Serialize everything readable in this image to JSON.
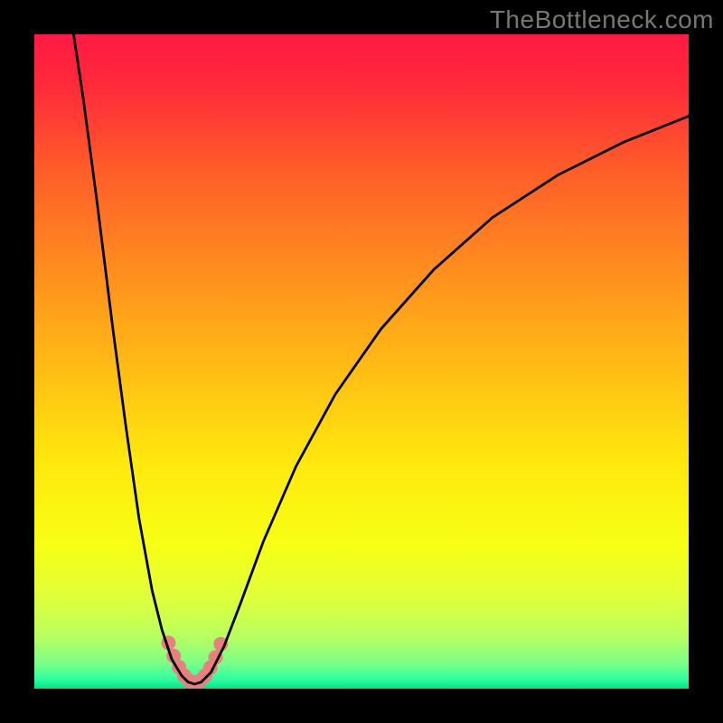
{
  "watermark": "TheBottleneck.com",
  "gradient": {
    "stops": [
      {
        "offset": 0.0,
        "color": "#ff1a44"
      },
      {
        "offset": 0.08,
        "color": "#ff2a3a"
      },
      {
        "offset": 0.2,
        "color": "#ff5a2a"
      },
      {
        "offset": 0.35,
        "color": "#ff8a1f"
      },
      {
        "offset": 0.5,
        "color": "#ffb915"
      },
      {
        "offset": 0.65,
        "color": "#ffe70e"
      },
      {
        "offset": 0.78,
        "color": "#f7ff14"
      },
      {
        "offset": 0.86,
        "color": "#e0ff3a"
      },
      {
        "offset": 0.92,
        "color": "#b8ff60"
      },
      {
        "offset": 0.96,
        "color": "#7dff86"
      },
      {
        "offset": 0.985,
        "color": "#30ffa0"
      },
      {
        "offset": 1.0,
        "color": "#00e585"
      }
    ]
  },
  "chart_data": {
    "type": "line",
    "title": "",
    "xlabel": "",
    "ylabel": "",
    "series": [
      {
        "name": "bottleneck-curve",
        "x_range_pct": [
          0,
          100
        ],
        "y_range_pct": [
          0,
          100
        ],
        "note": "Values are expressed as percent of plot width (x) and percent of plot height from top (y). Lower y means closer to top (worse bottleneck); y≈100 is the green optimum.",
        "points": [
          {
            "x_pct": 6.0,
            "y_pct": 0.0
          },
          {
            "x_pct": 7.5,
            "y_pct": 10.0
          },
          {
            "x_pct": 9.5,
            "y_pct": 25.0
          },
          {
            "x_pct": 12.0,
            "y_pct": 45.0
          },
          {
            "x_pct": 14.0,
            "y_pct": 60.0
          },
          {
            "x_pct": 16.0,
            "y_pct": 74.0
          },
          {
            "x_pct": 18.0,
            "y_pct": 85.0
          },
          {
            "x_pct": 19.5,
            "y_pct": 91.0
          },
          {
            "x_pct": 21.0,
            "y_pct": 95.5
          },
          {
            "x_pct": 22.5,
            "y_pct": 98.0
          },
          {
            "x_pct": 23.5,
            "y_pct": 99.0
          },
          {
            "x_pct": 24.5,
            "y_pct": 99.3
          },
          {
            "x_pct": 25.5,
            "y_pct": 99.0
          },
          {
            "x_pct": 27.0,
            "y_pct": 97.5
          },
          {
            "x_pct": 29.0,
            "y_pct": 93.5
          },
          {
            "x_pct": 31.5,
            "y_pct": 87.0
          },
          {
            "x_pct": 35.0,
            "y_pct": 77.5
          },
          {
            "x_pct": 40.0,
            "y_pct": 66.0
          },
          {
            "x_pct": 46.0,
            "y_pct": 55.0
          },
          {
            "x_pct": 53.0,
            "y_pct": 45.0
          },
          {
            "x_pct": 61.0,
            "y_pct": 36.0
          },
          {
            "x_pct": 70.0,
            "y_pct": 28.0
          },
          {
            "x_pct": 80.0,
            "y_pct": 21.5
          },
          {
            "x_pct": 90.0,
            "y_pct": 16.5
          },
          {
            "x_pct": 100.0,
            "y_pct": 12.5
          }
        ]
      },
      {
        "name": "highlight-dots",
        "color": "#e98080",
        "radius_px": 8,
        "points": [
          {
            "x_pct": 20.5,
            "y_pct": 93.0
          },
          {
            "x_pct": 21.3,
            "y_pct": 95.0
          },
          {
            "x_pct": 22.1,
            "y_pct": 96.7
          },
          {
            "x_pct": 22.9,
            "y_pct": 98.0
          },
          {
            "x_pct": 23.7,
            "y_pct": 98.8
          },
          {
            "x_pct": 24.5,
            "y_pct": 99.1
          },
          {
            "x_pct": 25.3,
            "y_pct": 98.8
          },
          {
            "x_pct": 26.1,
            "y_pct": 98.0
          },
          {
            "x_pct": 26.9,
            "y_pct": 96.8
          },
          {
            "x_pct": 27.7,
            "y_pct": 95.2
          },
          {
            "x_pct": 28.5,
            "y_pct": 93.2
          }
        ]
      }
    ],
    "xlim_pct": [
      0,
      100
    ],
    "ylim_pct": [
      0,
      100
    ]
  }
}
